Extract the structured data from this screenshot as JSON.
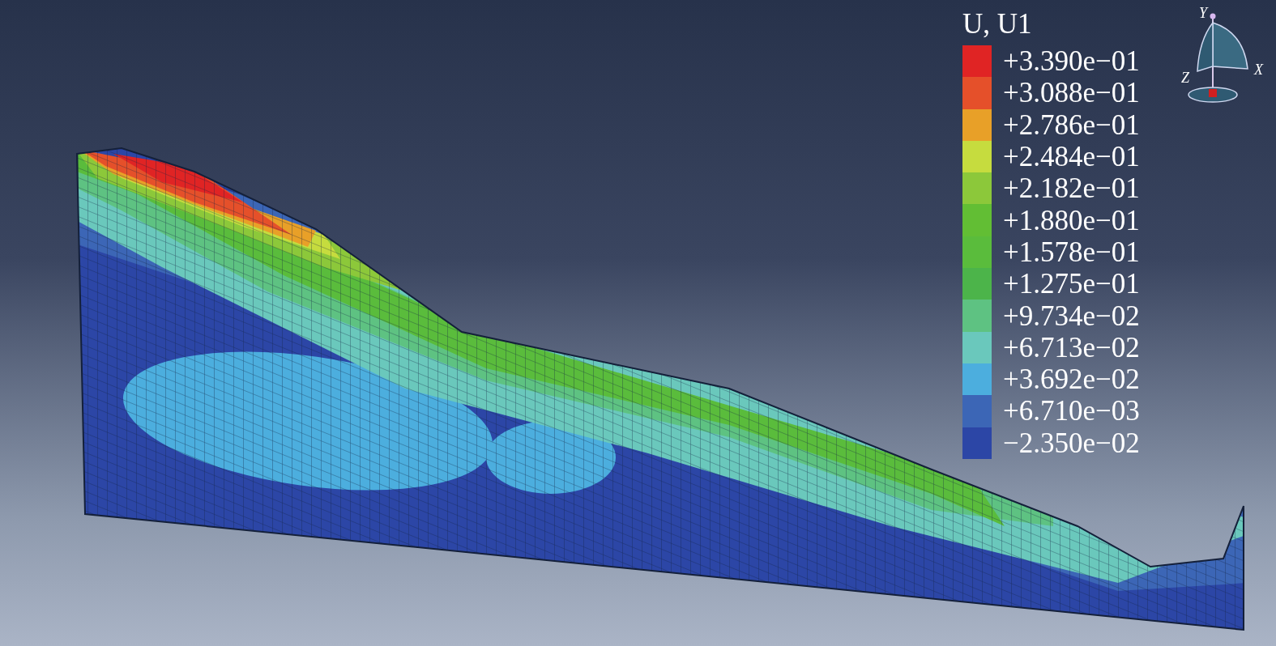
{
  "viewport": {
    "legend": {
      "title": "U, U1",
      "entries": [
        {
          "label": "+3.390e−01",
          "color": "#e02424"
        },
        {
          "label": "+3.088e−01",
          "color": "#e5502a"
        },
        {
          "label": "+2.786e−01",
          "color": "#e8a028"
        },
        {
          "label": "+2.484e−01",
          "color": "#c6dc3e"
        },
        {
          "label": "+2.182e−01",
          "color": "#8cc83a"
        },
        {
          "label": "+1.880e−01",
          "color": "#62be34"
        },
        {
          "label": "+1.578e−01",
          "color": "#5abc3c"
        },
        {
          "label": "+1.275e−01",
          "color": "#4cb44a"
        },
        {
          "label": "+9.734e−02",
          "color": "#5ec282"
        },
        {
          "label": "+6.713e−02",
          "color": "#6ac8bc"
        },
        {
          "label": "+3.692e−02",
          "color": "#4caede"
        },
        {
          "label": "+6.710e−03",
          "color": "#3c66b6"
        },
        {
          "label": "−2.350e−02",
          "color": "#2c46a6"
        }
      ]
    },
    "triad": {
      "labels": [
        "Y",
        "X",
        "Z"
      ]
    }
  }
}
